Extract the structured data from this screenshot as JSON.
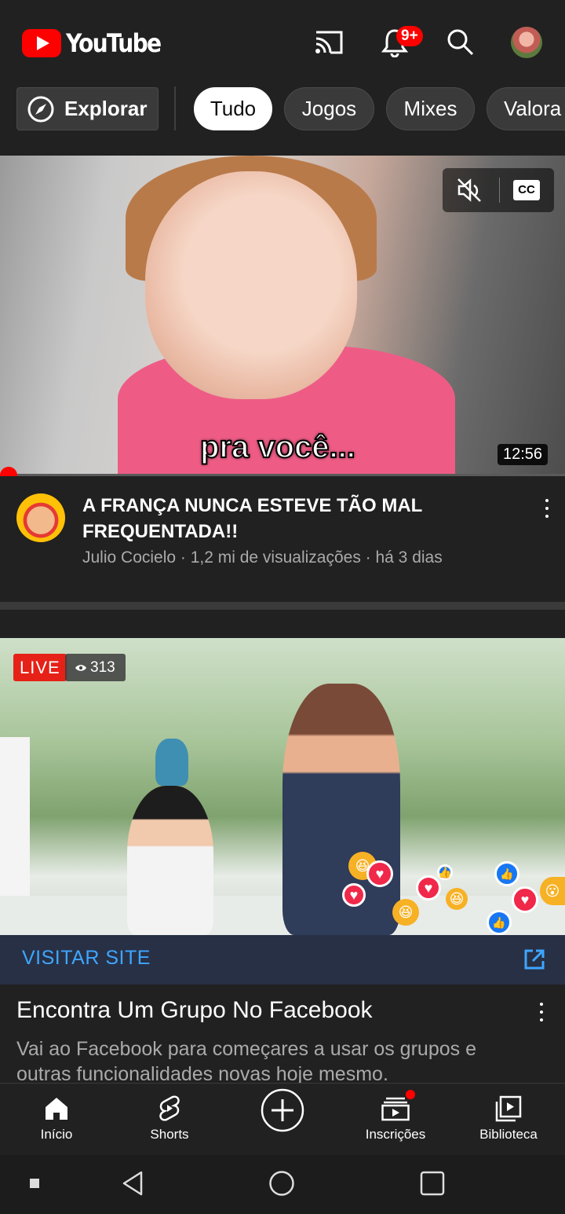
{
  "header": {
    "logo_text": "YouTube",
    "notification_count": "9+",
    "brand_color": "#ff0000"
  },
  "chips": {
    "explore_label": "Explorar",
    "items": [
      "Tudo",
      "Jogos",
      "Mixes",
      "Valora"
    ],
    "active": "Tudo"
  },
  "video1": {
    "caption_text": "pra você...",
    "duration": "12:56",
    "title": "A FRANÇA NUNCA ESTEVE TÃO MAL FREQUENTADA!!",
    "channel": "Julio Cocielo",
    "views": "1,2 mi de visualizações",
    "age": "há 3 dias",
    "subtitle": "Julio Cocielo · 1,2 mi de visualizações · há 3 dias"
  },
  "ad": {
    "live_label": "LIVE",
    "viewer_count": "313",
    "visit_label": "VISITAR SITE",
    "title": "Encontra Um Grupo No Facebook",
    "description": "Vai ao Facebook para começares a usar os grupos e outras funcionalidades novas hoje mesmo.",
    "accent_color": "#3ea6ff"
  },
  "bottom_nav": {
    "items": [
      {
        "label": "Início",
        "icon": "home-icon"
      },
      {
        "label": "Shorts",
        "icon": "shorts-icon"
      },
      {
        "label": "",
        "icon": "create-icon"
      },
      {
        "label": "Inscrições",
        "icon": "subscriptions-icon"
      },
      {
        "label": "Biblioteca",
        "icon": "library-icon"
      }
    ]
  }
}
